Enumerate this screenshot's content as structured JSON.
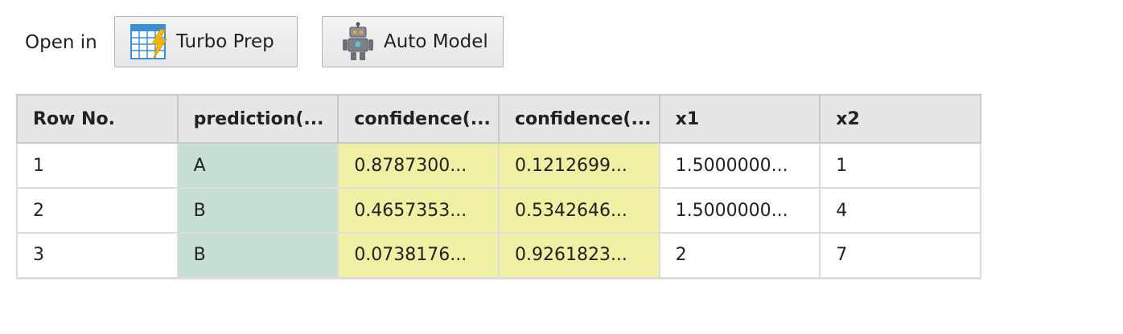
{
  "toolbar": {
    "open_in_label": "Open in",
    "turbo_prep_label": "Turbo Prep",
    "turbo_prep_icon": "turbo-prep-grid-lightning-icon",
    "auto_model_label": "Auto Model",
    "auto_model_icon": "robot-icon"
  },
  "colors": {
    "header_bg": "#e6e6e6",
    "prediction_bg": "#c6dfd2",
    "confidence_bg": "#f0f0a4",
    "grid_line": "#dcdcdc"
  },
  "table": {
    "columns": [
      "Row No.",
      "prediction(...",
      "confidence(...",
      "confidence(...",
      "x1",
      "x2"
    ],
    "rows": [
      [
        "1",
        "A",
        "0.8787300...",
        "0.1212699...",
        "1.5000000...",
        "1"
      ],
      [
        "2",
        "B",
        "0.4657353...",
        "0.5342646...",
        "1.5000000...",
        "4"
      ],
      [
        "3",
        "B",
        "0.0738176...",
        "0.9261823...",
        "2",
        "7"
      ]
    ]
  }
}
